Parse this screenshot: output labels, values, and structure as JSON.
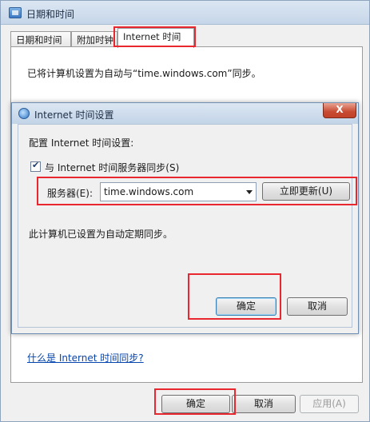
{
  "window": {
    "title": "日期和时间"
  },
  "tabs": [
    {
      "label": "日期和时间"
    },
    {
      "label": "附加时钟"
    },
    {
      "label": "Internet 时间"
    }
  ],
  "tab_content": {
    "sync_status": "已将计算机设置为自动与“time.windows.com”同步。",
    "help_link": "什么是 Internet 时间同步?"
  },
  "dialog": {
    "title": "Internet 时间设置",
    "close_symbol": "X",
    "config_label": "配置 Internet 时间设置:",
    "sync_checkbox_label": "与 Internet 时间服务器同步(S)",
    "sync_checked": true,
    "server_label": "服务器(E):",
    "server_value": "time.windows.com",
    "update_now_label": "立即更新(U)",
    "auto_sync_note": "此计算机已设置为自动定期同步。",
    "ok_label": "确定",
    "cancel_label": "取消"
  },
  "footer": {
    "ok_label": "确定",
    "cancel_label": "取消",
    "apply_label": "应用(A)"
  },
  "colors": {
    "highlight": "#e8282e",
    "link": "#0645ad"
  }
}
